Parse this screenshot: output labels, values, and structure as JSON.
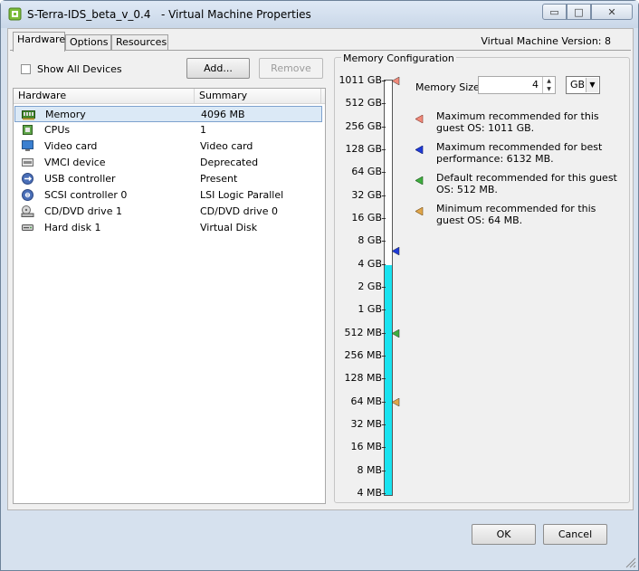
{
  "window": {
    "title": "S-Terra-IDS_beta_v_0.4   - Virtual Machine Properties",
    "minimize_glyph": "▭",
    "maximize_glyph": "□",
    "close_glyph": "✕"
  },
  "tabs": [
    {
      "label": "Hardware",
      "active": true
    },
    {
      "label": "Options",
      "active": false
    },
    {
      "label": "Resources",
      "active": false
    }
  ],
  "version_label": "Virtual Machine Version: 8",
  "toolbar": {
    "show_all_devices": "Show All Devices",
    "add_label": "Add...",
    "remove_label": "Remove"
  },
  "hardware_list": {
    "columns": [
      "Hardware",
      "Summary"
    ],
    "rows": [
      {
        "name": "Memory",
        "summary": "4096 MB",
        "icon": "memory-icon",
        "selected": true
      },
      {
        "name": "CPUs",
        "summary": "1",
        "icon": "cpu-icon",
        "selected": false
      },
      {
        "name": "Video card",
        "summary": "Video card",
        "icon": "monitor-icon",
        "selected": false
      },
      {
        "name": "VMCI device",
        "summary": "Deprecated",
        "icon": "vmci-icon",
        "selected": false
      },
      {
        "name": "USB controller",
        "summary": "Present",
        "icon": "usb-icon",
        "selected": false
      },
      {
        "name": "SCSI controller 0",
        "summary": "LSI Logic Parallel",
        "icon": "scsi-icon",
        "selected": false
      },
      {
        "name": "CD/DVD drive 1",
        "summary": "CD/DVD drive 0",
        "icon": "cdrom-icon",
        "selected": false
      },
      {
        "name": "Hard disk 1",
        "summary": "Virtual Disk",
        "icon": "harddisk-icon",
        "selected": false
      }
    ]
  },
  "memory": {
    "group_title": "Memory Configuration",
    "size_label": "Memory Size:",
    "size_value": "4",
    "unit": "GB",
    "scale_labels": [
      "1011 GB",
      "512 GB",
      "256 GB",
      "128 GB",
      "64 GB",
      "32 GB",
      "16 GB",
      "8 GB",
      "4 GB",
      "2 GB",
      "1 GB",
      "512 MB",
      "256 MB",
      "128 MB",
      "64 MB",
      "32 MB",
      "16 MB",
      "8 MB",
      "4 MB"
    ],
    "current_level_label": "4 GB",
    "recommendations": [
      {
        "text": "Maximum recommended for this guest OS: 1011 GB.",
        "color": "#f08a7a",
        "level_label": "1011 GB"
      },
      {
        "text": "Maximum recommended for best performance: 6132 MB.",
        "color": "#1f3bd8",
        "level_label": "6132 MB"
      },
      {
        "text": "Default recommended for this guest OS: 512 MB.",
        "color": "#3fae3f",
        "level_label": "512 MB"
      },
      {
        "text": "Minimum recommended for this guest OS: 64 MB.",
        "color": "#e0a64a",
        "level_label": "64 MB"
      }
    ],
    "fill_color": "#19e3f0"
  },
  "footer": {
    "ok_label": "OK",
    "cancel_label": "Cancel"
  }
}
